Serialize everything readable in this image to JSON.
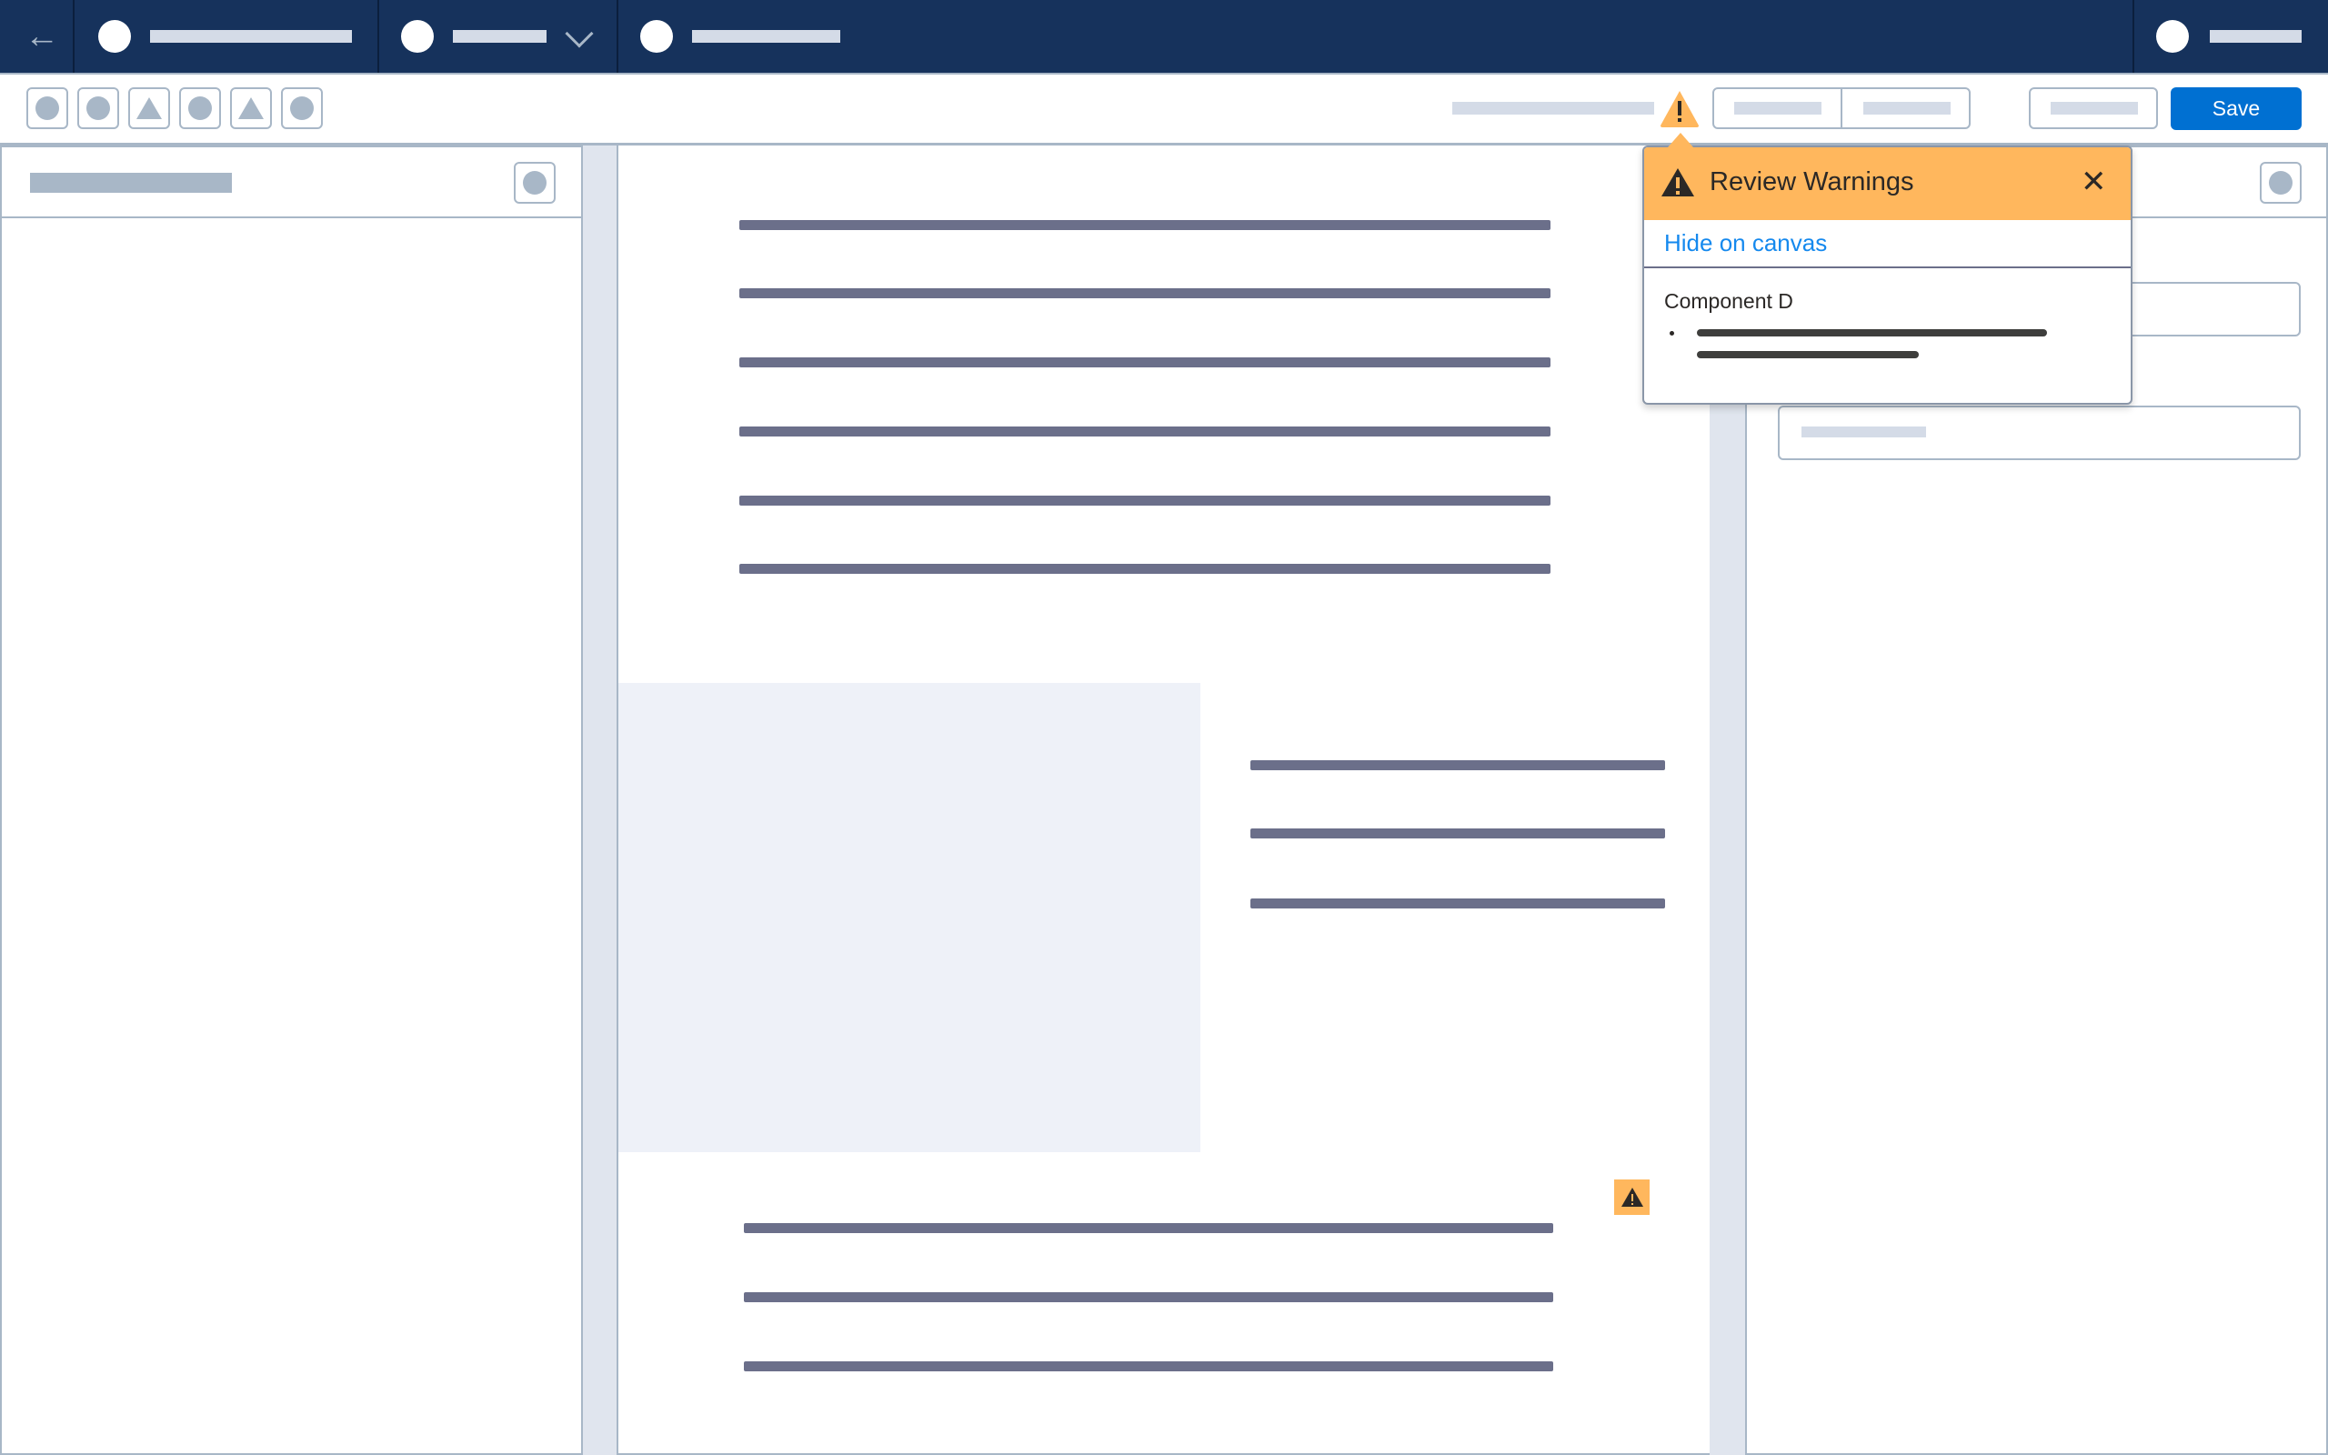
{
  "toolbar": {
    "save_label": "Save"
  },
  "popover": {
    "title": "Review Warnings",
    "hide_link": "Hide on canvas",
    "component": "Component D"
  },
  "colors": {
    "nav": "#16325c",
    "accent": "#0070d2",
    "warning": "#ffb75d",
    "link": "#1589ee"
  },
  "icons": [
    "back-arrow-icon",
    "chevron-down-icon",
    "warning-icon",
    "close-icon"
  ]
}
